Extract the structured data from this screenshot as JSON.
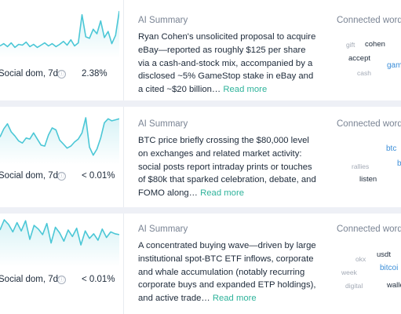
{
  "rows": [
    {
      "metric_label": "Social dom, 7d",
      "metric_value": "2.38%",
      "sparkline": [
        14,
        17,
        13,
        18,
        12,
        16,
        15,
        19,
        13,
        16,
        12,
        15,
        18,
        14,
        17,
        13,
        16,
        20,
        15,
        22,
        14,
        18,
        55,
        26,
        24,
        36,
        30,
        47,
        25,
        33,
        17,
        28,
        60
      ],
      "summary_title": "AI Summary",
      "summary_text": "Ryan Cohen's unsolicited proposal to acquire eBay—reported as roughly $125 per share via a cash-and-stock mix, accompanied by a disclosed ~5% GameStop stake in eBay and a cited ~$20 billion…",
      "read_more": "Read more",
      "connected_title": "Connected words",
      "words": [
        "gift",
        "cohen",
        "accept",
        "cash",
        "gam"
      ]
    },
    {
      "metric_label": "Social dom, 7d",
      "metric_value": "< 0.01%",
      "sparkline": [
        26,
        34,
        39,
        31,
        27,
        22,
        20,
        25,
        24,
        30,
        24,
        18,
        17,
        28,
        35,
        33,
        23,
        19,
        15,
        17,
        21,
        24,
        30,
        45,
        16,
        8,
        14,
        25,
        40,
        44,
        42,
        43,
        44
      ],
      "summary_title": "AI Summary",
      "summary_text": "BTC price briefly crossing the $80,000 level on exchanges and related market activity: social posts report intraday prints or touches of $80k that sparked celebration, debate, and FOMO along…",
      "read_more": "Read more",
      "connected_title": "Connected words",
      "words": [
        "btc",
        "b",
        "rallies",
        "listen"
      ]
    },
    {
      "metric_label": "Social dom, 7d",
      "metric_value": "< 0.01%",
      "sparkline": [
        38,
        49,
        44,
        36,
        46,
        37,
        48,
        28,
        43,
        39,
        33,
        45,
        24,
        41,
        35,
        26,
        38,
        31,
        40,
        22,
        37,
        29,
        34,
        27,
        39,
        30,
        36,
        34,
        33
      ],
      "summary_title": "AI Summary",
      "summary_text": "A concentrated buying wave—driven by large institutional spot-BTC ETF inflows, corporate and whale accumulation (notably recurring corporate buys and expanded ETP holdings), and active trade…",
      "read_more": "Read more",
      "connected_title": "Connected words",
      "words": [
        "usdt",
        "okx",
        "week",
        "bitcoi",
        "digital",
        "walle"
      ]
    }
  ],
  "colors": {
    "sparkline_stroke": "#4bc7d6",
    "read_more": "#2fb39b",
    "accent_word": "#3b8ed8",
    "background": "#eef0f6"
  },
  "icons": {
    "info": "ⓘ"
  }
}
